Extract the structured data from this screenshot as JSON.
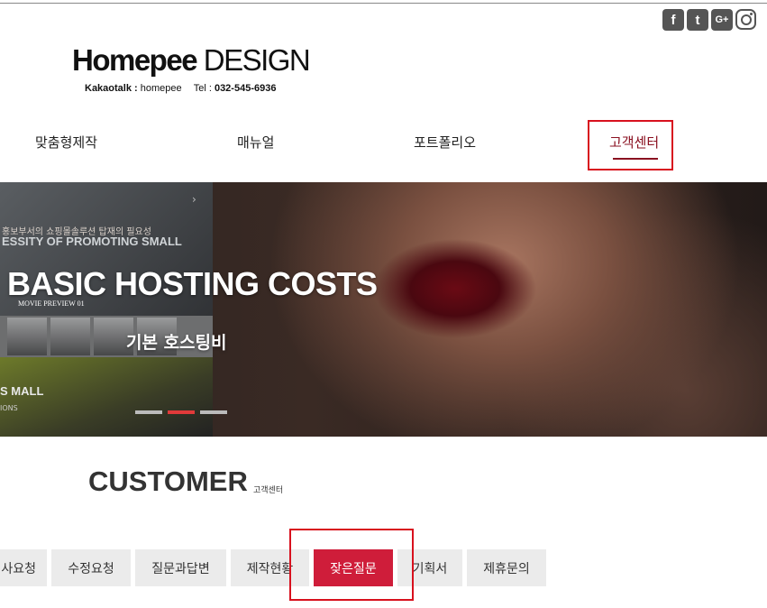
{
  "social": [
    {
      "icon": "facebook-icon",
      "glyph": "f"
    },
    {
      "icon": "twitter-icon",
      "glyph": "t"
    },
    {
      "icon": "google-plus-icon",
      "glyph": "G+"
    },
    {
      "icon": "instagram-icon",
      "glyph": ""
    }
  ],
  "logo": {
    "brand_bold": "Homepee",
    "brand_light": " DESIGN",
    "kakao_label": "Kakaotalk :",
    "kakao_id": " homepee",
    "tel_label": "Tel :",
    "tel_number": " 032-545-6936"
  },
  "nav": {
    "items": [
      "맞춤형제작",
      "매뉴얼",
      "포트폴리오",
      "고객센터"
    ],
    "active": "고객센터"
  },
  "banner": {
    "thumb_text_1": "홍보부서의 쇼핑몰솔루션 탑재의 필요성",
    "thumb_text_2": "ESSITY OF PROMOTING SMALL",
    "thumb_text_3": "MOVIE PREVIEW 01",
    "thumb_text_4": "S MALL",
    "thumb_text_5": "IONS",
    "title": "BASIC HOSTING COSTS",
    "subtitle": "기본 호스팅비",
    "active_slide": 2,
    "slide_count": 3
  },
  "section": {
    "title": "CUSTOMER",
    "subtitle": "고객센터"
  },
  "tabs": {
    "items": [
      "사요청",
      "수정요청",
      "질문과답변",
      "제작현황",
      "잦은질문",
      "기획서",
      "제휴문의"
    ],
    "active": "잦은질문"
  },
  "colors": {
    "accent": "#cf1d3a",
    "nav_active": "#8a1020",
    "highlight": "#d8111e"
  }
}
